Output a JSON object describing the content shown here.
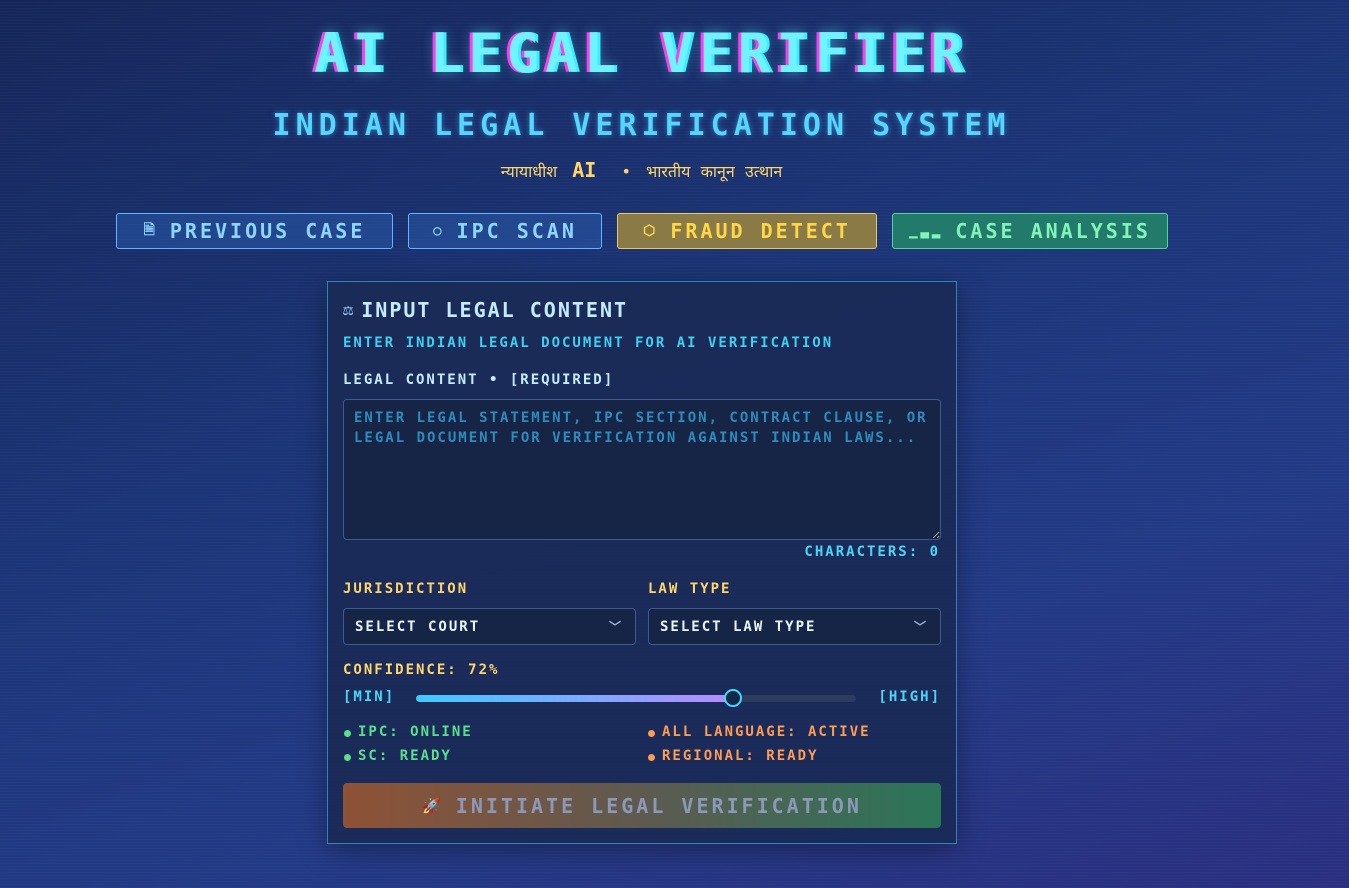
{
  "header": {
    "title": "AI LEGAL VERIFIER",
    "subtitle": "INDIAN LEGAL VERIFICATION SYSTEM",
    "tagline_left": "न्यायाधीश",
    "tagline_ai": "AI",
    "tagline_dot": "•",
    "tagline_right": "भारतीय  कानून  उत्थान"
  },
  "nav": {
    "previous_case": "PREVIOUS CASE",
    "ipc_scan": "IPC SCAN",
    "fraud_detect": "FRAUD DETECT",
    "case_analysis": "CASE ANALYSIS",
    "icons": {
      "previous_case": "document-icon",
      "ipc_scan": "search-icon",
      "fraud_detect": "shield-icon",
      "case_analysis": "bar-chart-icon"
    },
    "colors": {
      "fraud_detect": "#ffd84a",
      "case_analysis": "#83f3b9"
    }
  },
  "card": {
    "title": "INPUT LEGAL CONTENT",
    "title_icon": "scales-icon",
    "subtitle": "ENTER INDIAN LEGAL DOCUMENT FOR AI VERIFICATION",
    "content_label": "LEGAL CONTENT • [REQUIRED]",
    "content_placeholder": "ENTER LEGAL STATEMENT, IPC SECTION, CONTRACT CLAUSE, OR LEGAL DOCUMENT FOR VERIFICATION AGAINST INDIAN LAWS...",
    "content_value": "",
    "characters": "CHARACTERS: 0",
    "jurisdiction_label": "JURISDICTION",
    "jurisdiction_value": "SELECT COURT",
    "law_type_label": "LAW TYPE",
    "law_type_value": "SELECT LAW TYPE",
    "confidence_label": "CONFIDENCE: 72%",
    "confidence_value": 72,
    "slider_min": "[MIN]",
    "slider_max": "[HIGH]",
    "status": {
      "ipc": "IPC: ONLINE",
      "sc": "SC: READY",
      "all_language": "ALL LANGUAGE: ACTIVE",
      "regional": "REGIONAL: READY"
    },
    "submit": "INITIATE LEGAL VERIFICATION",
    "submit_icon": "rocket-icon"
  }
}
